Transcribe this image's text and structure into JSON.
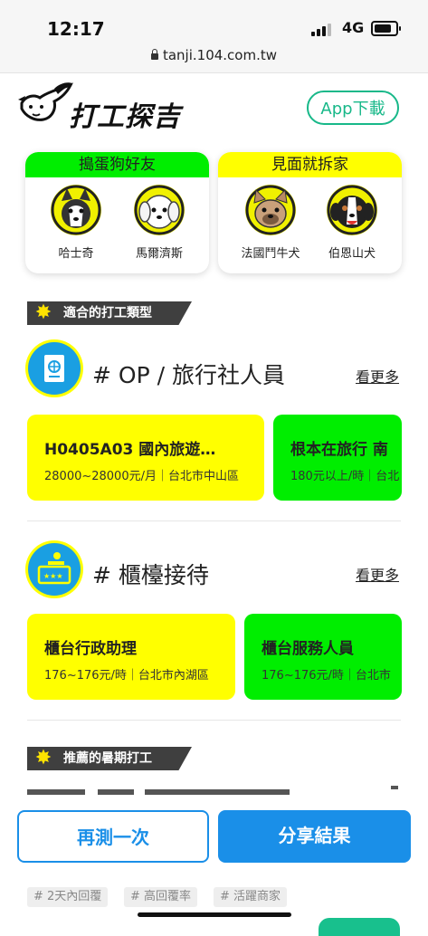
{
  "status_bar": {
    "time": "12:17",
    "network": "4G"
  },
  "browser": {
    "url": "tanji.104.com.tw"
  },
  "header": {
    "logo_text": "打工探吉",
    "app_button": "App下載"
  },
  "dog_cards": [
    {
      "title": "搗蛋狗好友",
      "head_color": "#00ee00",
      "dogs": [
        "哈士奇",
        "馬爾濟斯"
      ]
    },
    {
      "title": "見面就拆家",
      "head_color": "#ffff00",
      "dogs": [
        "法國鬥牛犬",
        "伯恩山犬"
      ]
    }
  ],
  "section_suitable": {
    "label": "適合的打工類型"
  },
  "categories": [
    {
      "title": "# OP / 旅行社人員",
      "more": "看更多",
      "icon": "passport-icon",
      "jobs": [
        {
          "title": "H0405A03 國內旅遊…",
          "sub": "28000~28000元/月｜台北市中山區",
          "color": "#ffff00"
        },
        {
          "title": "根本在旅行 南",
          "sub": "180元以上/時｜台北",
          "color": "#00ee00"
        }
      ]
    },
    {
      "title": "# 櫃檯接待",
      "more": "看更多",
      "icon": "reception-desk-icon",
      "jobs": [
        {
          "title": "櫃台行政助理",
          "sub": "176~176元/時｜台北市內湖區",
          "color": "#ffff00"
        },
        {
          "title": "櫃台服務人員",
          "sub": "176~176元/時｜台北市",
          "color": "#00ee00"
        }
      ]
    }
  ],
  "section_summer": {
    "label": "推薦的暑期打工"
  },
  "actions": {
    "retry": "再測一次",
    "share": "分享結果",
    "retry_color": "#1a8fe8",
    "share_color": "#1a8fe8"
  },
  "tags": [
    "# 2天內回覆",
    "# 高回覆率",
    "# 活躍商家"
  ]
}
